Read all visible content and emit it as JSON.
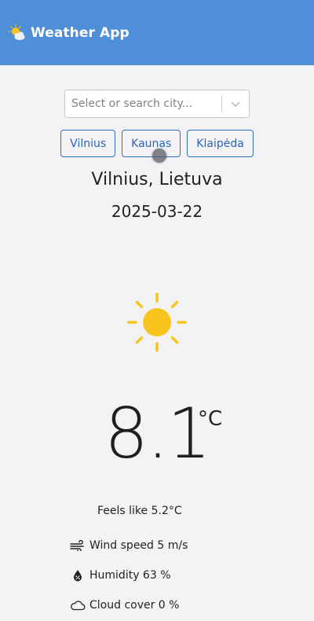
{
  "header": {
    "title": "Weather App",
    "icon": "sun-behind-cloud-icon"
  },
  "search": {
    "placeholder": "Select or search city...",
    "value": ""
  },
  "cities": [
    {
      "label": "Vilnius"
    },
    {
      "label": "Kaunas"
    },
    {
      "label": "Klaipėda"
    }
  ],
  "weather": {
    "location": "Vilnius, Lietuva",
    "date": "2025-03-22",
    "condition_icon": "sun-icon",
    "temperature": "8.1",
    "unit": "°C",
    "feels_like": "Feels like 5.2°C",
    "wind": "Wind speed 5 m/s",
    "humidity": "Humidity 63 %",
    "cloud": "Cloud cover 0 %"
  },
  "colors": {
    "header_bg": "#4f8fd8",
    "accent": "#2f6fc0",
    "sun": "#f7c51e"
  }
}
